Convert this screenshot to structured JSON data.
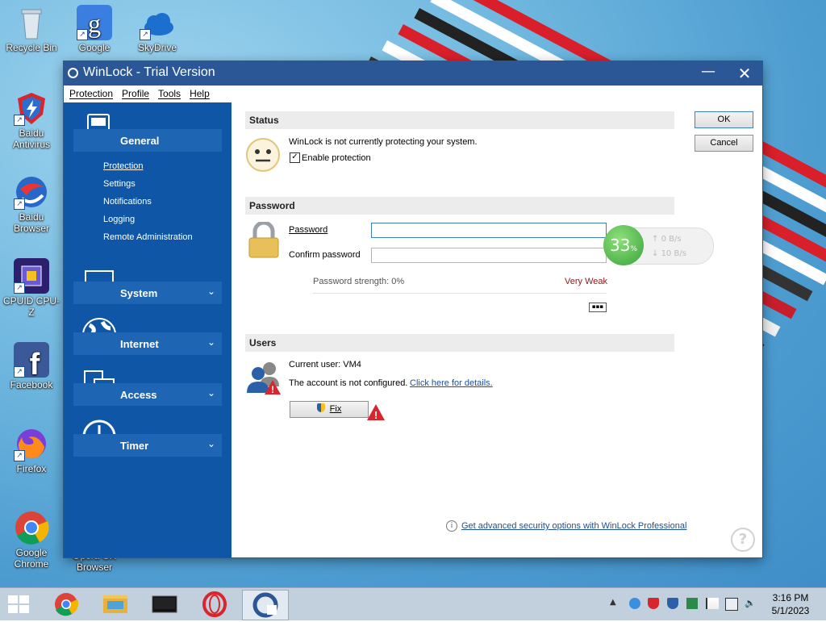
{
  "desktop": {
    "icons": [
      {
        "label": "Recycle Bin",
        "icon": "recycle-bin-icon"
      },
      {
        "label": "Google",
        "icon": "google-icon"
      },
      {
        "label": "SkyDrive",
        "icon": "skydrive-icon"
      },
      {
        "label": "Baidu Antivirus",
        "icon": "baidu-antivirus-icon"
      },
      {
        "label": "Baidu Browser",
        "icon": "baidu-browser-icon"
      },
      {
        "label": "CPUID CPU-Z",
        "icon": "cpuz-icon"
      },
      {
        "label": "Facebook",
        "icon": "facebook-icon"
      },
      {
        "label": "Firefox",
        "icon": "firefox-icon"
      },
      {
        "label": "Google Chrome",
        "icon": "chrome-icon"
      },
      {
        "label": "Opera GX Browser",
        "icon": "opera-gx-icon"
      }
    ]
  },
  "window": {
    "title": "WinLock - Trial Version",
    "menu": [
      "Protection",
      "Profile",
      "Tools",
      "Help"
    ],
    "sidebar": {
      "general": {
        "label": "General",
        "items": [
          "Protection",
          "Settings",
          "Notifications",
          "Logging",
          "Remote Administration"
        ]
      },
      "system": {
        "label": "System"
      },
      "internet": {
        "label": "Internet"
      },
      "access": {
        "label": "Access"
      },
      "timer": {
        "label": "Timer"
      }
    },
    "status": {
      "heading": "Status",
      "message": "WinLock is not currently protecting your system.",
      "enable_label": "Enable protection",
      "enable_checked": true
    },
    "password": {
      "heading": "Password",
      "password_label": "Password",
      "confirm_label": "Confirm password",
      "password_value": "",
      "confirm_value": "",
      "strength_label": "Password strength: 0%",
      "strength_rating": "Very Weak"
    },
    "users": {
      "heading": "Users",
      "current_user": "Current user:  VM4",
      "not_configured": "The account is not configured.",
      "details_link": "Click here for details.",
      "fix_label": "Fix"
    },
    "footer_link": "Get advanced security options with WinLock Professional",
    "ok_label": "OK",
    "cancel_label": "Cancel"
  },
  "overlay": {
    "percent": "33",
    "unit": "%",
    "upload": "0 B/s",
    "download": "10 B/s"
  },
  "taskbar": {
    "time": "3:16 PM",
    "date": "5/1/2023"
  },
  "colors": {
    "sidebar": "#0f57a6",
    "titlebar": "#2b5797",
    "taskbar": "#c2cfdd",
    "weak": "#8b1a1a"
  }
}
